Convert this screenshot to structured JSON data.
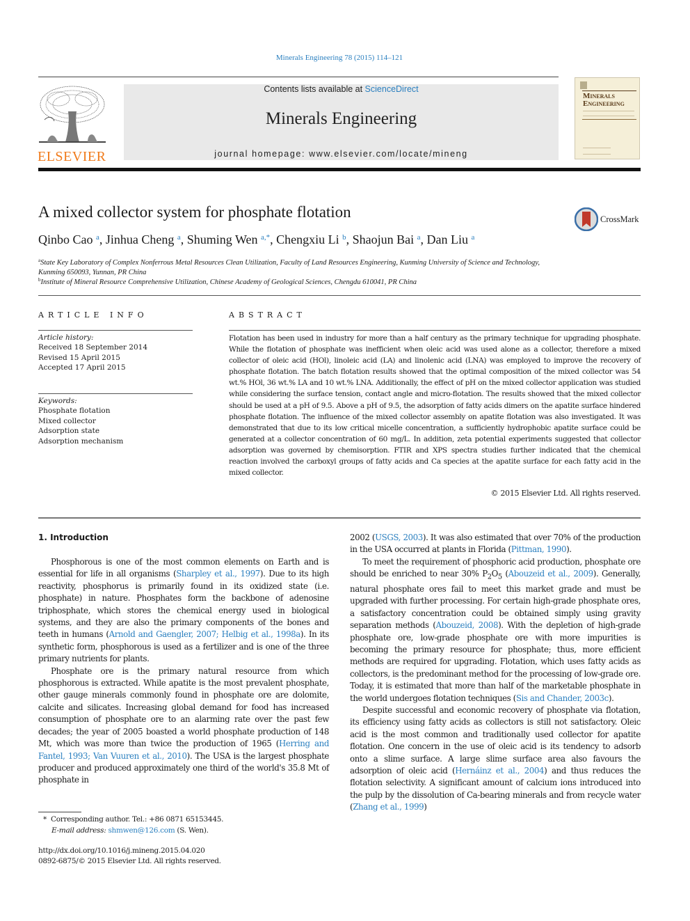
{
  "header": {
    "journal_reference": "Minerals Engineering 78 (2015) 114–121",
    "contents_prefix": "Contents lists available at ",
    "contents_link": "ScienceDirect",
    "journal_title": "Minerals Engineering",
    "homepage_prefix": "journal homepage: ",
    "homepage_url": "www.elsevier.com/locate/mineng",
    "publisher_logo_text": "ELSEVIER",
    "cover": {
      "title_line1": "Minerals",
      "title_line2": "Engineering"
    },
    "colors": {
      "link": "#2a7fbf",
      "elsevier_orange": "#f07a1a",
      "masthead_bg": "#e9e9e9"
    }
  },
  "article": {
    "title": "A mixed collector system for phosphate flotation",
    "crossmark_label": "CrossMark",
    "authors": [
      {
        "name": "Qinbo Cao",
        "sup": "a",
        "sep": ", "
      },
      {
        "name": "Jinhua Cheng",
        "sup": "a",
        "sep": ", "
      },
      {
        "name": "Shuming Wen",
        "sup": "a,*",
        "sep": ", "
      },
      {
        "name": "Chengxiu Li",
        "sup": "b",
        "sep": ", "
      },
      {
        "name": "Shaojun Bai",
        "sup": "a",
        "sep": ", "
      },
      {
        "name": "Dan Liu",
        "sup": "a",
        "sep": ""
      }
    ],
    "affiliations": [
      {
        "mark": "a",
        "line1": "State Key Laboratory of Complex Nonferrous Metal Resources Clean Utilization, Faculty of Land Resources Engineering, Kunming University of Science and Technology,",
        "line2": "Kunming 650093, Yunnan, PR China"
      },
      {
        "mark": "b",
        "line1": "Institute of Mineral Resource Comprehensive Utilization, Chinese Academy of Geological Sciences, Chengdu 610041, PR China",
        "line2": ""
      }
    ]
  },
  "article_info": {
    "label": "ARTICLE INFO",
    "history_heading": "Article history:",
    "history": [
      "Received 18 September 2014",
      "Revised 15 April 2015",
      "Accepted 17 April 2015"
    ],
    "keywords_heading": "Keywords:",
    "keywords": [
      "Phosphate flotation",
      "Mixed collector",
      "Adsorption state",
      "Adsorption mechanism"
    ]
  },
  "abstract": {
    "label": "ABSTRACT",
    "text": "Flotation has been used in industry for more than a half century as the primary technique for upgrading phosphate. While the flotation of phosphate was inefficient when oleic acid was used alone as a collector, therefore a mixed collector of oleic acid (HOl), linoleic acid (LA) and linolenic acid (LNA) was employed to improve the recovery of phosphate flotation. The batch flotation results showed that the optimal composition of the mixed collector was 54 wt.% HOl, 36 wt.% LA and 10 wt.% LNA. Additionally, the effect of pH on the mixed collector application was studied while considering the surface tension, contact angle and micro-flotation. The results showed that the mixed collector should be used at a pH of 9.5. Above a pH of 9.5, the adsorption of fatty acids dimers on the apatite surface hindered phosphate flotation. The influence of the mixed collector assembly on apatite flotation was also investigated. It was demonstrated that due to its low critical micelle concentration, a sufficiently hydrophobic apatite surface could be generated at a collector concentration of 60 mg/L. In addition, zeta potential experiments suggested that collector adsorption was governed by chemisorption. FTIR and XPS spectra studies further indicated that the chemical reaction involved the carboxyl groups of fatty acids and Ca species at the apatite surface for each fatty acid in the mixed collector.",
    "copyright": "© 2015 Elsevier Ltd. All rights reserved."
  },
  "body": {
    "section_heading": "1. Introduction",
    "left_column": [
      [
        {
          "t": "Phosphorous is one of the most common elements on Earth and is essential for life in all organisms ("
        },
        {
          "l": "Sharpley et al., 1997"
        },
        {
          "t": "). Due to its high reactivity, phosphorus is primarily found in its oxidized state (i.e. phosphate) in nature. Phosphates form the backbone of adenosine triphosphate, which stores the chemical energy used in biological systems, and they are also the primary components of the bones and teeth in humans ("
        },
        {
          "l": "Arnold and Gaengler, 2007; Helbig et al., 1998a"
        },
        {
          "t": "). In its synthetic form, phosphorous is used as a fertilizer and is one of the three primary nutrients for plants."
        }
      ],
      [
        {
          "t": "Phosphate ore is the primary natural resource from which phosphorous is extracted. While apatite is the most prevalent phosphate, other gauge minerals commonly found in phosphate ore are dolomite, calcite and silicates. Increasing global demand for food has increased consumption of phosphate ore to an alarming rate over the past few decades; the year of 2005 boasted a world phosphate production of 148 Mt, which was more than twice the production of 1965 ("
        },
        {
          "l": "Herring and Fantel, 1993; Van Vuuren et al., 2010"
        },
        {
          "t": "). The USA is the largest phosphate producer and produced approximately one third of the world's 35.8 Mt of phosphate in"
        }
      ]
    ],
    "right_column": [
      [
        {
          "t": "2002 ("
        },
        {
          "l": "USGS, 2003"
        },
        {
          "t": "). It was also estimated that over 70% of the production in the USA occurred at plants in Florida ("
        },
        {
          "l": "Pittman, 1990"
        },
        {
          "t": ")."
        }
      ],
      [
        {
          "t": "To meet the requirement of phosphoric acid production, phosphate ore should be enriched to near 30% P"
        },
        {
          "sub": "2"
        },
        {
          "t": "O"
        },
        {
          "sub": "5"
        },
        {
          "t": " ("
        },
        {
          "l": "Abouzeid et al., 2009"
        },
        {
          "t": "). Generally, natural phosphate ores fail to meet this market grade and must be upgraded with further processing. For certain high-grade phosphate ores, a satisfactory concentration could be obtained simply using gravity separation methods ("
        },
        {
          "l": "Abouzeid, 2008"
        },
        {
          "t": "). With the depletion of high-grade phosphate ore, low-grade phosphate ore with more impurities is becoming the primary resource for phosphate; thus, more efficient methods are required for upgrading. Flotation, which uses fatty acids as collectors, is the predominant method for the processing of low-grade ore. Today, it is estimated that more than half of the marketable phosphate in the world undergoes flotation techniques ("
        },
        {
          "l": "Sis and Chander, 2003c"
        },
        {
          "t": ")."
        }
      ],
      [
        {
          "t": "Despite successful and economic recovery of phosphate via flotation, its efficiency using fatty acids as collectors is still not satisfactory. Oleic acid is the most common and traditionally used collector for apatite flotation. One concern in the use of oleic acid is its tendency to adsorb onto a slime surface. A large slime surface area also favours the adsorption of oleic acid ("
        },
        {
          "l": "Hernáinz et al., 2004"
        },
        {
          "t": ") and thus reduces the flotation selectivity. A significant amount of calcium ions introduced into the pulp by the dissolution of Ca-bearing minerals and from recycle water ("
        },
        {
          "l": "Zhang et al., 1999"
        },
        {
          "t": ")"
        }
      ]
    ]
  },
  "footnotes": {
    "corresponding": "Corresponding author. Tel.: +86 0871 65153445.",
    "corresponding_mark": "*",
    "email_label": "E-mail address: ",
    "email": "shmwen@126.com",
    "email_suffix": " (S. Wen).",
    "doi": "http://dx.doi.org/10.1016/j.mineng.2015.04.020",
    "issn_copyright": "0892-6875/© 2015 Elsevier Ltd. All rights reserved."
  }
}
